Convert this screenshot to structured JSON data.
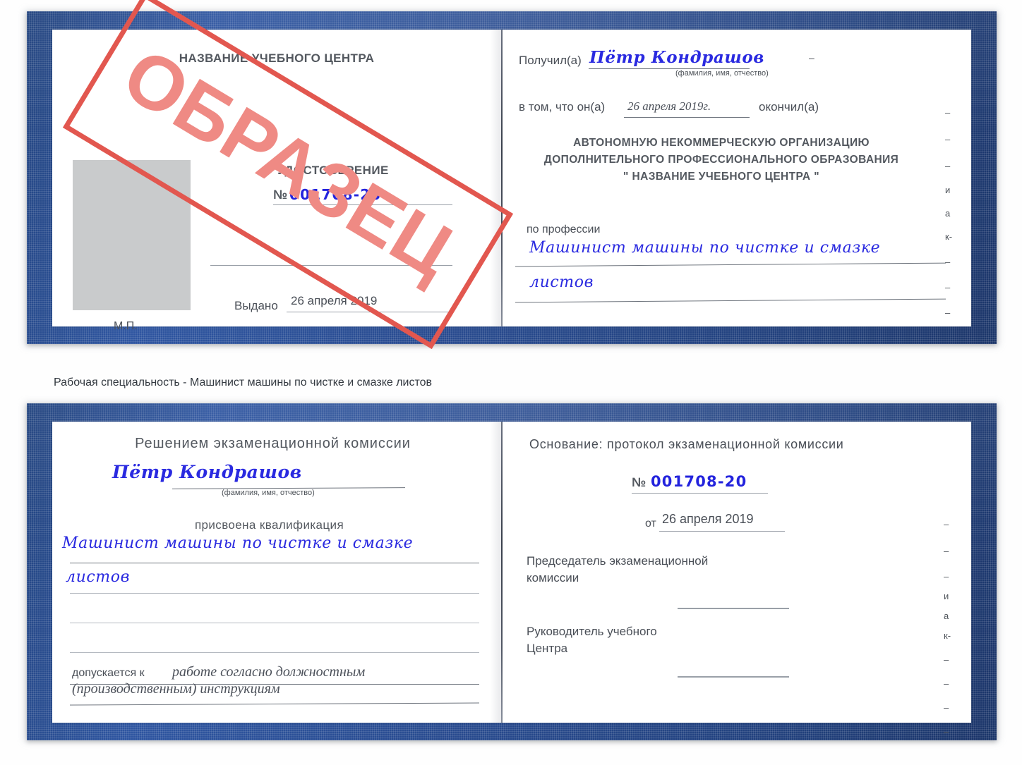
{
  "caption": "Рабочая специальность - Машинист машины по чистке и смазке листов",
  "stamp": {
    "text": "ОБРАЗЕЦ",
    "color": "#e2574f",
    "text_color": "#ef8a84"
  },
  "colors": {
    "cover": "#27498c",
    "handwriting": "#2a2ae0",
    "photo_placeholder": "#c9cbcc",
    "rule": "#9aa0a8"
  },
  "certificate": {
    "left_page": {
      "org_title": "НАЗВАНИЕ УЧЕБНОГО ЦЕНТРА",
      "doc_type": "УДОСТОВЕРЕНИЕ",
      "number_label": "№",
      "number_value": "001708-20",
      "issued_label": "Выдано",
      "issued_value": "26 апреля 2019",
      "seal_label": "М.П."
    },
    "right_page": {
      "received_label": "Получил(а)",
      "received_value": "Пётр Кондрашов",
      "name_hint": "(фамилия, имя, отчество)",
      "that_he_label": "в том, что он(а)",
      "completion_date": "26 апреля 2019г.",
      "finished_label": "окончил(а)",
      "org_line1": "АВТОНОМНУЮ НЕКОММЕРЧЕСКУЮ ОРГАНИЗАЦИЮ",
      "org_line2": "ДОПОЛНИТЕЛЬНОГО ПРОФЕССИОНАЛЬНОГО ОБРАЗОВАНИЯ",
      "org_line3": "\"     НАЗВАНИЕ УЧЕБНОГО ЦЕНТРА        \"",
      "profession_label": "по профессии",
      "profession_value_line1": "Машинист машины по чистке и смазке",
      "profession_value_line2": "листов",
      "edge_fragments": [
        "–",
        "–",
        "–",
        "–",
        "и",
        "а",
        "к-",
        "–",
        "–",
        "–",
        "–"
      ]
    }
  },
  "protocol": {
    "left_page": {
      "commission_title": "Решением экзаменационной комиссии",
      "name_value": "Пётр Кондрашов",
      "name_hint": "(фамилия, имя, отчество)",
      "qualification_label": "присвоена квалификация",
      "qualification_line1": "Машинист машины по чистке и смазке",
      "qualification_line2": "листов",
      "admitted_label": "допускается к",
      "admitted_value_line1": "работе согласно должностным",
      "admitted_value_line2": "(производственным) инструкциям"
    },
    "right_page": {
      "basis_label": "Основание: протокол экзаменационной комиссии",
      "number_label": "№",
      "number_value": "001708-20",
      "date_label": "от",
      "date_value": "26 апреля 2019",
      "chairman_line1": "Председатель экзаменационной",
      "chairman_line2": "комиссии",
      "director_line1": "Руководитель учебного",
      "director_line2": "Центра",
      "edge_fragments": [
        "–",
        "–",
        "–",
        "и",
        "а",
        "к-",
        "–",
        "–",
        "–",
        "–"
      ]
    }
  }
}
